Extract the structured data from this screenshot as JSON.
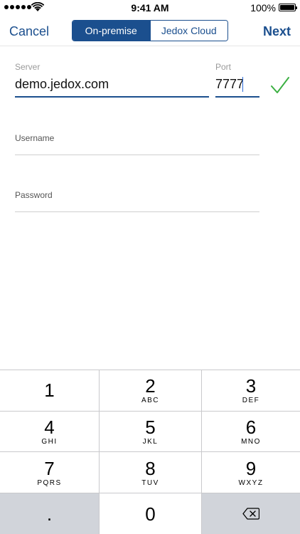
{
  "status_bar": {
    "time": "9:41 AM",
    "battery_percent": "100%",
    "signal_bars": 5
  },
  "nav": {
    "cancel_label": "Cancel",
    "next_label": "Next",
    "segments": [
      {
        "label": "On-premise",
        "selected": true
      },
      {
        "label": "Jedox Cloud",
        "selected": false
      }
    ]
  },
  "form": {
    "server": {
      "label": "Server",
      "value": "demo.jedox.com"
    },
    "port": {
      "label": "Port",
      "value": "7777"
    },
    "username": {
      "label": "Username",
      "value": ""
    },
    "password": {
      "label": "Password",
      "value": ""
    }
  },
  "keyboard": {
    "keys": [
      {
        "digit": "1",
        "letters": ""
      },
      {
        "digit": "2",
        "letters": "ABC"
      },
      {
        "digit": "3",
        "letters": "DEF"
      },
      {
        "digit": "4",
        "letters": "GHI"
      },
      {
        "digit": "5",
        "letters": "JKL"
      },
      {
        "digit": "6",
        "letters": "MNO"
      },
      {
        "digit": "7",
        "letters": "PQRS"
      },
      {
        "digit": "8",
        "letters": "TUV"
      },
      {
        "digit": "9",
        "letters": "WXYZ"
      },
      {
        "digit": ".",
        "letters": ""
      },
      {
        "digit": "0",
        "letters": ""
      }
    ]
  },
  "colors": {
    "accent": "#1b4f8e",
    "check": "#3cb043",
    "keyboard_gray": "#d1d4da"
  },
  "icons": {
    "valid": "checkmark-icon",
    "delete": "backspace-icon"
  }
}
